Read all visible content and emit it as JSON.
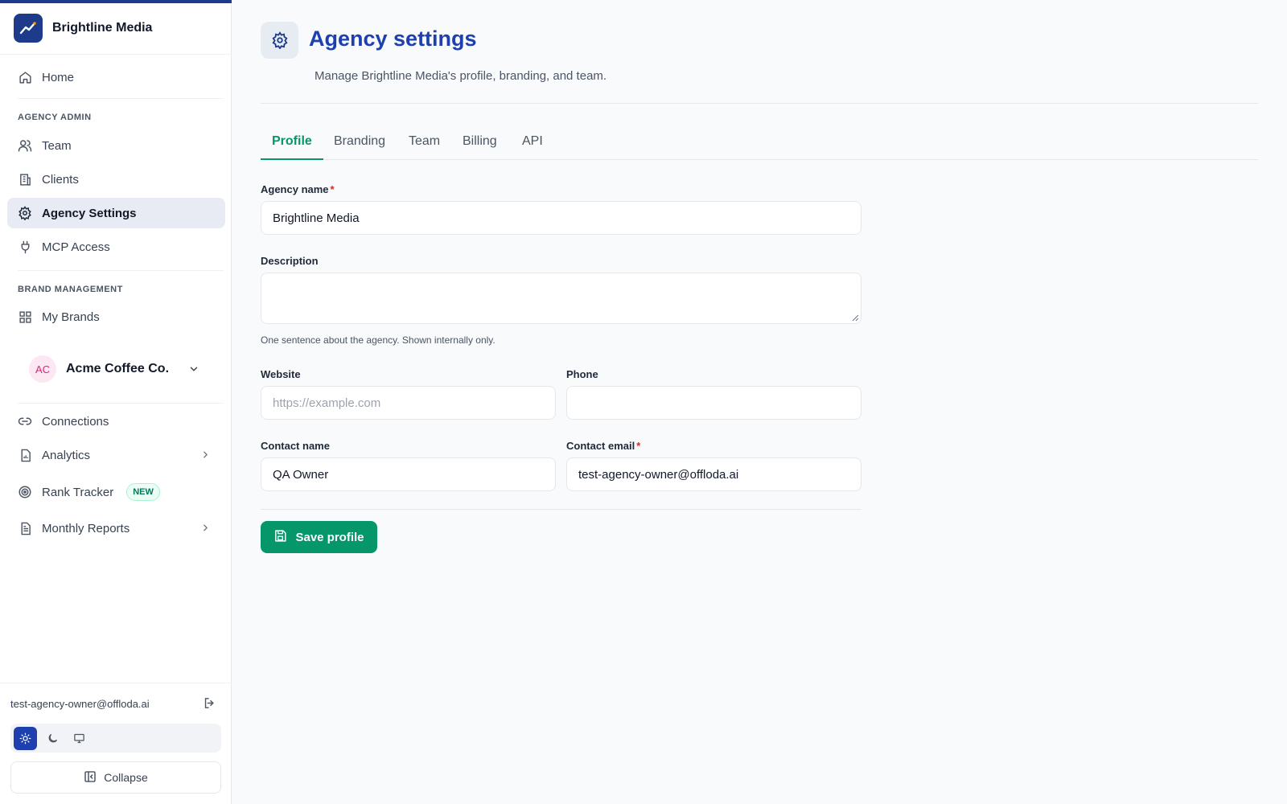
{
  "brand": {
    "name": "Brightline Media"
  },
  "nav": {
    "home": "Home",
    "sections": {
      "agency_admin": "AGENCY ADMIN",
      "brand_management": "BRAND MANAGEMENT"
    },
    "team": "Team",
    "clients": "Clients",
    "agency_settings": "Agency Settings",
    "mcp_access": "MCP Access",
    "my_brands": "My Brands",
    "connections": "Connections",
    "analytics": "Analytics",
    "rank_tracker": "Rank Tracker",
    "rank_tracker_badge": "NEW",
    "monthly_reports": "Monthly Reports"
  },
  "current_brand": {
    "initials": "AC",
    "name": "Acme Coffee Co."
  },
  "footer": {
    "email": "test-agency-owner@offloda.ai",
    "theme_options": [
      "light",
      "dark",
      "system"
    ],
    "theme_selected": "light",
    "collapse_label": "Collapse"
  },
  "page": {
    "title": "Agency settings",
    "subtitle": "Manage Brightline Media's profile, branding, and team."
  },
  "tabs": [
    {
      "label": "Profile",
      "active": true
    },
    {
      "label": "Branding",
      "active": false
    },
    {
      "label": "Team",
      "active": false
    },
    {
      "label": "Billing",
      "active": false
    },
    {
      "label": "API",
      "active": false
    }
  ],
  "form": {
    "agency_name": {
      "label": "Agency name",
      "required_mark": "*",
      "value": "Brightline Media"
    },
    "description": {
      "label": "Description",
      "value": "",
      "help": "One sentence about the agency. Shown internally only."
    },
    "website": {
      "label": "Website",
      "value": "",
      "placeholder": "https://example.com"
    },
    "phone": {
      "label": "Phone",
      "value": ""
    },
    "contact_name": {
      "label": "Contact name",
      "value": "QA Owner"
    },
    "contact_email": {
      "label": "Contact email",
      "required_mark": "*",
      "value": "test-agency-owner@offloda.ai"
    },
    "save_label": "Save profile"
  },
  "colors": {
    "accent_green": "#059669",
    "brand_navy": "#1e3a8a",
    "title_blue": "#1e40af",
    "required_red": "#dc2626"
  }
}
